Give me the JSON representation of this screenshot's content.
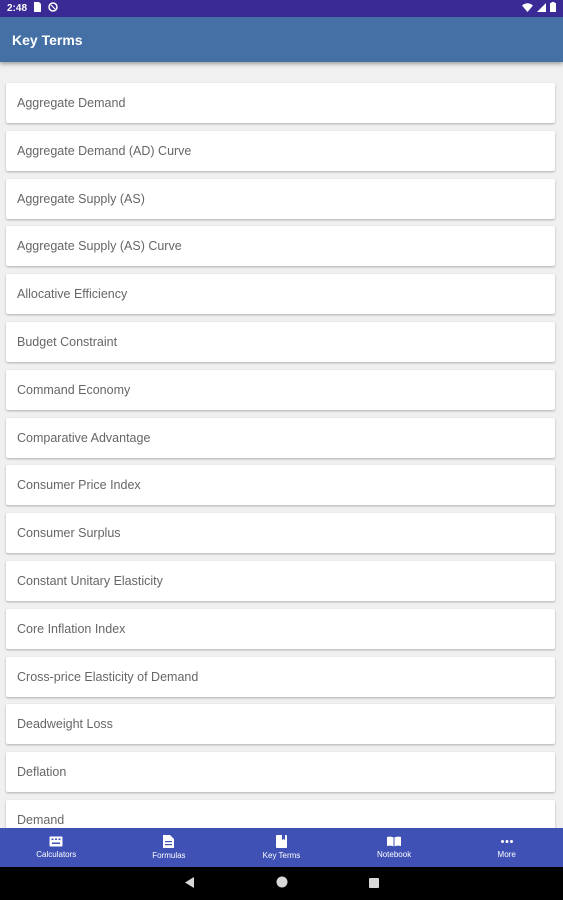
{
  "status_bar": {
    "time": "2:48",
    "icons": [
      "sim-card-icon",
      "vpn-icon",
      "wifi-icon",
      "signal-icon",
      "battery-icon"
    ]
  },
  "app_bar": {
    "title": "Key Terms"
  },
  "terms": [
    "Aggregate Demand",
    "Aggregate Demand (AD) Curve",
    "Aggregate Supply (AS)",
    "Aggregate Supply (AS) Curve",
    "Allocative Efficiency",
    "Budget Constraint",
    "Command Economy",
    "Comparative Advantage",
    "Consumer Price Index",
    "Consumer Surplus",
    "Constant Unitary Elasticity",
    "Core Inflation Index",
    "Cross-price Elasticity of Demand",
    "Deadweight Loss",
    "Deflation",
    "Demand"
  ],
  "bottom_nav": [
    {
      "label": "Calculators",
      "icon": "calculator-icon"
    },
    {
      "label": "Formulas",
      "icon": "document-icon"
    },
    {
      "label": "Key Terms",
      "icon": "book-icon"
    },
    {
      "label": "Notebook",
      "icon": "notebook-icon"
    },
    {
      "label": "More",
      "icon": "more-icon"
    }
  ],
  "colors": {
    "status_bar": "#3a2a96",
    "app_bar": "#4470a6",
    "bottom_nav": "#3f51b5",
    "background": "#f0f0f0",
    "item_text": "#666666"
  }
}
